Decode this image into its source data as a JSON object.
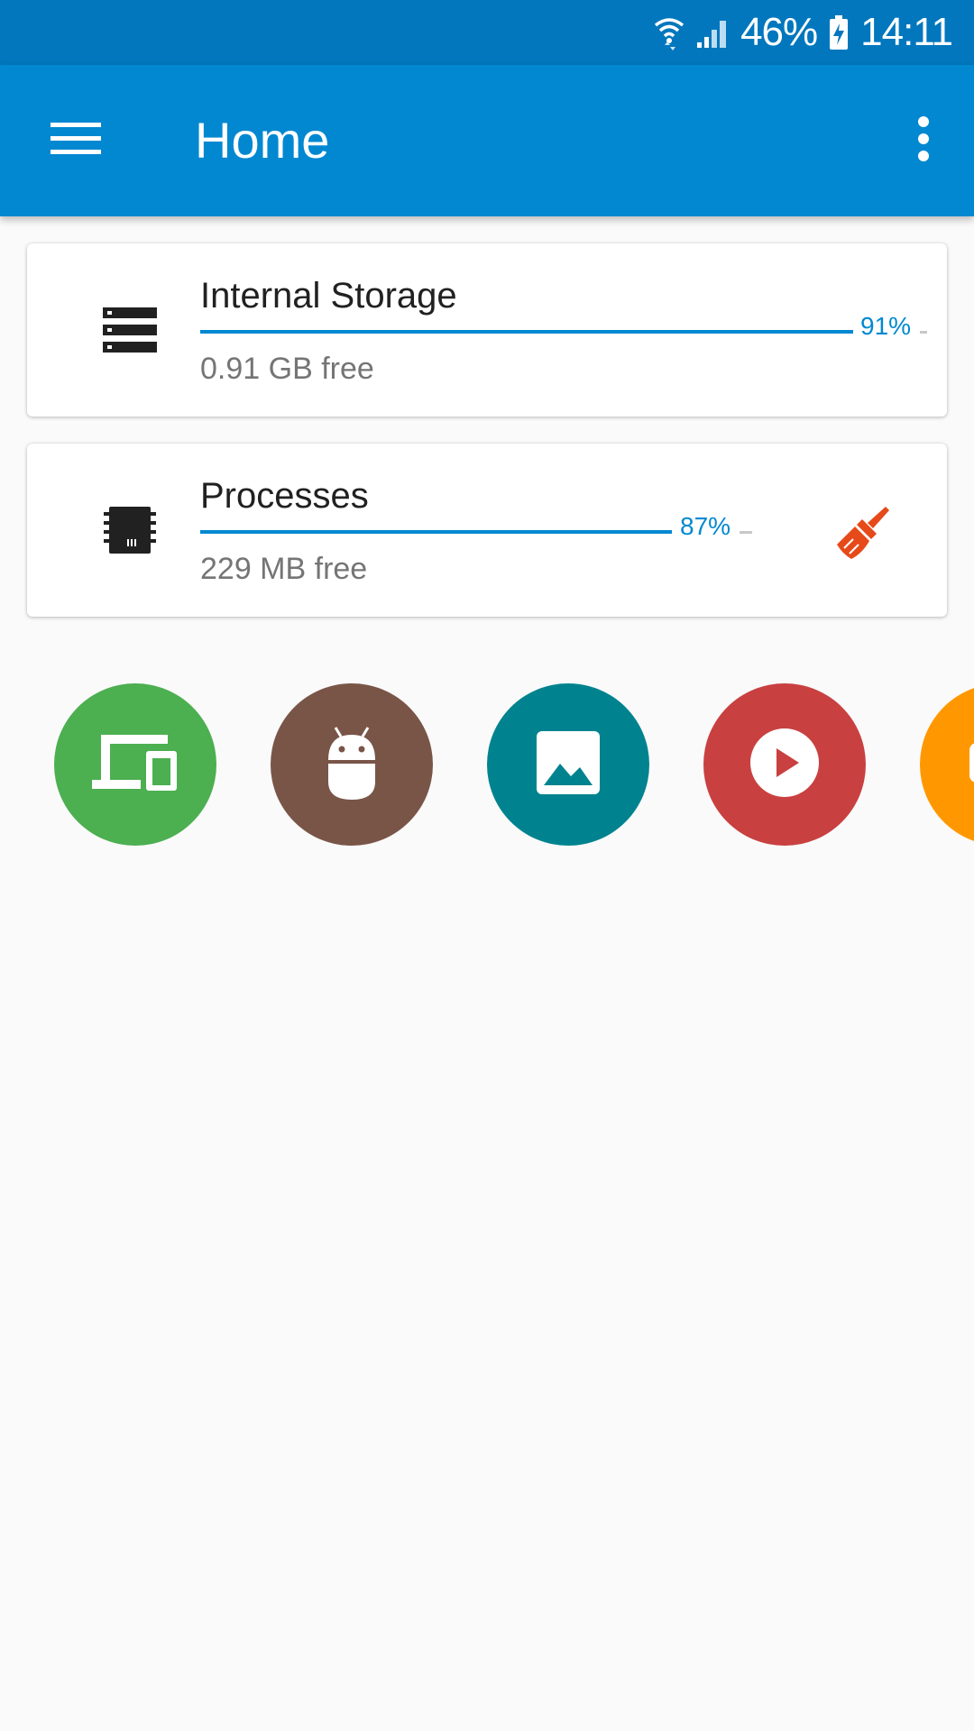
{
  "status_bar": {
    "battery_percent": "46%",
    "time": "14:11",
    "icons": [
      "wifi-icon",
      "signal-icon",
      "battery-charging-icon"
    ]
  },
  "app_bar": {
    "title": "Home",
    "menu_icon": "hamburger-menu-icon",
    "overflow_icon": "more-vert-icon"
  },
  "cards": [
    {
      "title": "Internal Storage",
      "subtitle": "0.91 GB free",
      "percent_label": "91%",
      "percent": 91,
      "icon": "storage-icon"
    },
    {
      "title": "Processes",
      "subtitle": "229 MB free",
      "percent_label": "87%",
      "percent": 87,
      "icon": "memory-chip-icon",
      "action_icon": "broom-clean-icon"
    }
  ],
  "categories": [
    {
      "icon": "devices-icon",
      "color": "#4caf50"
    },
    {
      "icon": "android-icon",
      "color": "#795548"
    },
    {
      "icon": "image-icon",
      "color": "#00838f"
    },
    {
      "icon": "play-circle-icon",
      "color": "#c94040"
    },
    {
      "icon": "document-icon",
      "color": "#ff9800"
    }
  ],
  "colors": {
    "status_bar": "#0277bd",
    "app_bar": "#0288d1",
    "accent": "#0288d1",
    "clean_action": "#e64a19"
  }
}
